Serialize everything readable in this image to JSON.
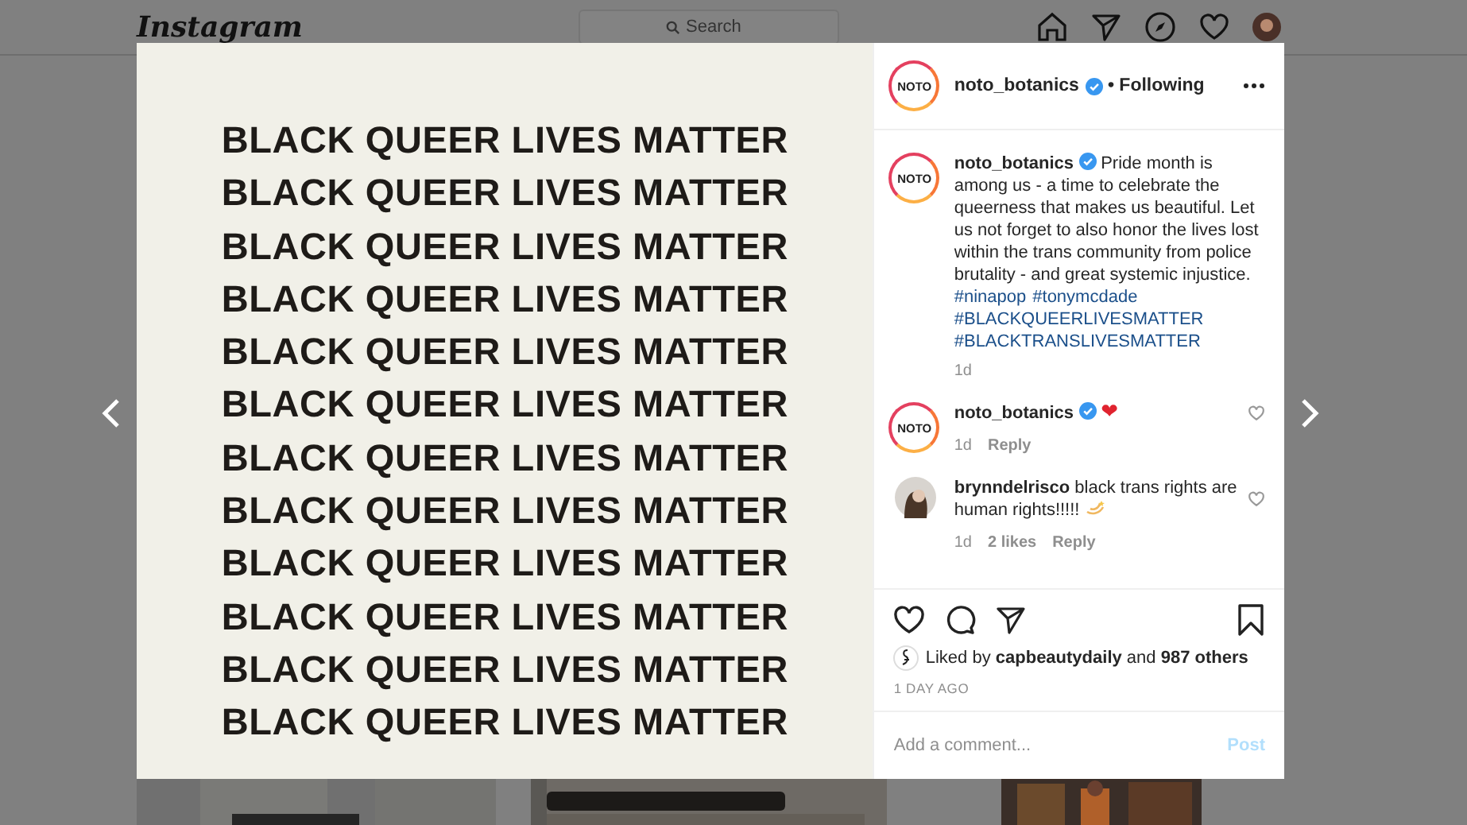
{
  "header": {
    "logo": "Instagram",
    "search": {
      "placeholder": "Search"
    }
  },
  "post": {
    "image_lines": [
      "BLACK QUEER LIVES MATTER",
      "BLACK QUEER LIVES MATTER",
      "BLACK QUEER LIVES MATTER",
      "BLACK QUEER LIVES MATTER",
      "BLACK QUEER LIVES MATTER",
      "BLACK QUEER LIVES MATTER",
      "BLACK QUEER LIVES MATTER",
      "BLACK QUEER LIVES MATTER",
      "BLACK QUEER LIVES MATTER",
      "BLACK QUEER LIVES MATTER",
      "BLACK QUEER LIVES MATTER",
      "BLACK QUEER LIVES MATTER"
    ],
    "author": {
      "name": "noto_botanics",
      "avatar": "NOTO",
      "verified": true,
      "follow": "• Following"
    },
    "caption": {
      "avatar": "NOTO",
      "name": "noto_botanics",
      "verified": true,
      "text": "Pride month is among us - a time to celebrate the queerness that makes us beautiful. Let us not forget to also honor the lives lost within the trans community from police brutality - and great systemic injustice.",
      "hashtags": [
        "#ninapop",
        "#tonymcdade",
        "#BLACKQUEERLIVESMATTER",
        "#BLACKTRANSLIVESMATTER"
      ],
      "time": "1d"
    }
  },
  "comments": [
    {
      "kind": "brand",
      "avatar": "NOTO",
      "name": "noto_botanics",
      "verified": true,
      "text": "❤",
      "time": "1d",
      "reply": "Reply"
    },
    {
      "kind": "person",
      "name": "brynndelrisco",
      "verified": false,
      "text": "black trans rights are human rights!!!!!",
      "time": "1d",
      "likes": "2 likes",
      "reply": "Reply"
    }
  ],
  "likes": {
    "text": "Liked by **capbeautydaily** and **987 others**"
  },
  "timestamp": "1 DAY AGO",
  "comment_box": {
    "placeholder": "Add a comment...",
    "post": "Post",
    "disabled": true
  }
}
